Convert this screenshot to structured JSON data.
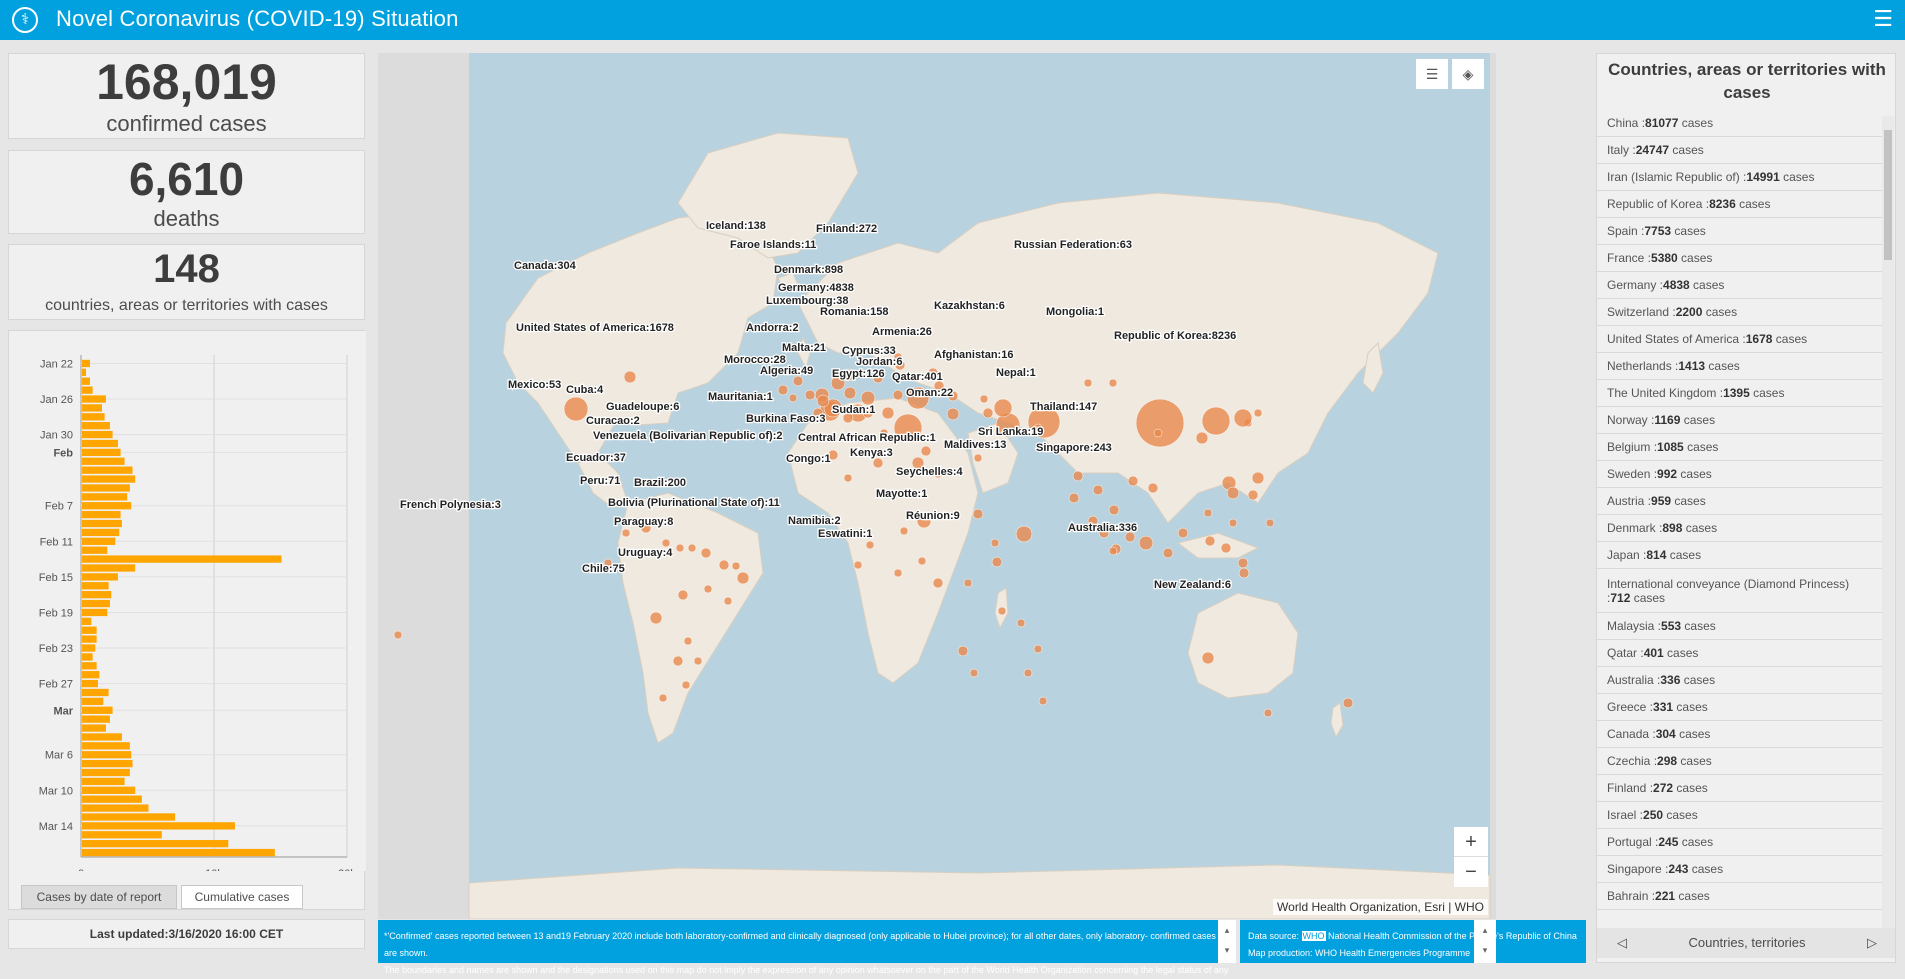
{
  "header": {
    "title": "Novel Coronavirus (COVID-19) Situation",
    "logo": "who-emblem",
    "menu_icon": "☰"
  },
  "stats": {
    "confirmed": "168,019",
    "confirmed_label": "confirmed cases",
    "deaths": "6,610",
    "deaths_label": "deaths",
    "countries": "148",
    "countries_label": "countries, areas or territories with cases"
  },
  "chart_data": {
    "type": "bar",
    "orientation": "horizontal",
    "x_ticks": [
      "0",
      "10k",
      "20k"
    ],
    "xlim": [
      0,
      20000
    ],
    "y_tick_labels": [
      {
        "label": "Jan 22",
        "index": 0,
        "bold": false
      },
      {
        "label": "Jan 26",
        "index": 4,
        "bold": false
      },
      {
        "label": "Jan 30",
        "index": 8,
        "bold": false
      },
      {
        "label": "Feb",
        "index": 10,
        "bold": true
      },
      {
        "label": "Feb 7",
        "index": 16,
        "bold": false
      },
      {
        "label": "Feb 11",
        "index": 20,
        "bold": false
      },
      {
        "label": "Feb 15",
        "index": 24,
        "bold": false
      },
      {
        "label": "Feb 19",
        "index": 28,
        "bold": false
      },
      {
        "label": "Feb 23",
        "index": 32,
        "bold": false
      },
      {
        "label": "Feb 27",
        "index": 36,
        "bold": false
      },
      {
        "label": "Mar",
        "index": 39,
        "bold": true
      },
      {
        "label": "Mar 6",
        "index": 44,
        "bold": false
      },
      {
        "label": "Mar 10",
        "index": 48,
        "bold": false
      },
      {
        "label": "Mar 14",
        "index": 52,
        "bold": false
      }
    ],
    "values": [
      600,
      300,
      600,
      800,
      1800,
      1500,
      1700,
      2100,
      2300,
      2700,
      2900,
      3200,
      3800,
      4000,
      3600,
      3400,
      3700,
      2900,
      3000,
      2800,
      2500,
      1900,
      15000,
      4000,
      2700,
      2000,
      2200,
      2100,
      1900,
      700,
      1100,
      1100,
      1000,
      800,
      1100,
      1300,
      1200,
      2000,
      1600,
      2300,
      2100,
      1800,
      3000,
      3600,
      3700,
      3800,
      3600,
      3200,
      4000,
      4500,
      5000,
      7000,
      11500,
      6000,
      11000,
      14500
    ],
    "color": "#ffa500"
  },
  "chart_tabs": {
    "by_date": "Cases by date of report",
    "cumulative": "Cumulative cases"
  },
  "updated": "Last updated:3/16/2020 16:00 CET",
  "map": {
    "attribution": "World Health Organization, Esri | WHO",
    "zoom_in": "+",
    "zoom_out": "−",
    "legend_icon": "legend-list-icon",
    "layers_icon": "layers-icon",
    "labels": [
      {
        "text": "Iceland:138",
        "x": 328,
        "y": 176
      },
      {
        "text": "Finland:272",
        "x": 438,
        "y": 179
      },
      {
        "text": "Faroe Islands:11",
        "x": 352,
        "y": 195
      },
      {
        "text": "Russian Federation:63",
        "x": 636,
        "y": 195
      },
      {
        "text": "Canada:304",
        "x": 136,
        "y": 216
      },
      {
        "text": "Denmark:898",
        "x": 396,
        "y": 220
      },
      {
        "text": "Germany:4838",
        "x": 400,
        "y": 238
      },
      {
        "text": "Luxembourg:38",
        "x": 388,
        "y": 251
      },
      {
        "text": "Kazakhstan:6",
        "x": 556,
        "y": 256
      },
      {
        "text": "Romania:158",
        "x": 442,
        "y": 262
      },
      {
        "text": "Mongolia:1",
        "x": 668,
        "y": 262
      },
      {
        "text": "Andorra:2",
        "x": 368,
        "y": 278
      },
      {
        "text": "United States of America:1678",
        "x": 138,
        "y": 278
      },
      {
        "text": "Armenia:26",
        "x": 494,
        "y": 282
      },
      {
        "text": "Republic of Korea:8236",
        "x": 736,
        "y": 286
      },
      {
        "text": "Malta:21",
        "x": 404,
        "y": 298
      },
      {
        "text": "Cyprus:33",
        "x": 464,
        "y": 301
      },
      {
        "text": "Afghanistan:16",
        "x": 556,
        "y": 305
      },
      {
        "text": "Morocco:28",
        "x": 346,
        "y": 310
      },
      {
        "text": "Jordan:6",
        "x": 478,
        "y": 312
      },
      {
        "text": "Algeria:49",
        "x": 382,
        "y": 321
      },
      {
        "text": "Egypt:126",
        "x": 454,
        "y": 324
      },
      {
        "text": "Nepal:1",
        "x": 618,
        "y": 323
      },
      {
        "text": "Qatar:401",
        "x": 514,
        "y": 327
      },
      {
        "text": "Mexico:53",
        "x": 130,
        "y": 335
      },
      {
        "text": "Cuba:4",
        "x": 188,
        "y": 340
      },
      {
        "text": "Oman:22",
        "x": 528,
        "y": 343
      },
      {
        "text": "Mauritania:1",
        "x": 330,
        "y": 347
      },
      {
        "text": "Guadeloupe:6",
        "x": 228,
        "y": 357
      },
      {
        "text": "Sudan:1",
        "x": 454,
        "y": 360
      },
      {
        "text": "Thailand:147",
        "x": 652,
        "y": 357
      },
      {
        "text": "Burkina Faso:3",
        "x": 368,
        "y": 369
      },
      {
        "text": "Curacao:2",
        "x": 208,
        "y": 371
      },
      {
        "text": "Sri Lanka:19",
        "x": 600,
        "y": 382
      },
      {
        "text": "Central African Republic:1",
        "x": 420,
        "y": 388
      },
      {
        "text": "Venezuela (Bolivarian Republic of):2",
        "x": 215,
        "y": 386
      },
      {
        "text": "Maldives:13",
        "x": 566,
        "y": 395
      },
      {
        "text": "Singapore:243",
        "x": 658,
        "y": 398
      },
      {
        "text": "Kenya:3",
        "x": 472,
        "y": 403
      },
      {
        "text": "Congo:1",
        "x": 408,
        "y": 409
      },
      {
        "text": "Ecuador:37",
        "x": 188,
        "y": 408
      },
      {
        "text": "Seychelles:4",
        "x": 518,
        "y": 422
      },
      {
        "text": "Peru:71",
        "x": 202,
        "y": 431
      },
      {
        "text": "Brazil:200",
        "x": 256,
        "y": 433
      },
      {
        "text": "Mayotte:1",
        "x": 498,
        "y": 444
      },
      {
        "text": "Bolivia (Plurinational State of):11",
        "x": 230,
        "y": 453
      },
      {
        "text": "French Polynesia:3",
        "x": 22,
        "y": 455
      },
      {
        "text": "Réunion:9",
        "x": 528,
        "y": 466
      },
      {
        "text": "Namibia:2",
        "x": 410,
        "y": 471
      },
      {
        "text": "Paraguay:8",
        "x": 236,
        "y": 472
      },
      {
        "text": "Australia:336",
        "x": 690,
        "y": 478
      },
      {
        "text": "Eswatini:1",
        "x": 440,
        "y": 484
      },
      {
        "text": "Uruguay:4",
        "x": 240,
        "y": 503
      },
      {
        "text": "Chile:75",
        "x": 204,
        "y": 519
      },
      {
        "text": "New Zealand:6",
        "x": 776,
        "y": 535
      }
    ]
  },
  "footer": {
    "left_line1": "*'Confirmed' cases reported between 13 and19 February 2020 include both laboratory-confirmed and clinically diagnosed (only  applicable to Hubei province); for all other dates, only laboratory-  confirmed cases are shown.",
    "left_line2": "The boundaries and names are shown and the designations used on this map do not imply the expression of any opinion whatsoever on the part of the World Health Organization concerning the legal status of any country, territory,",
    "right_line1_a": "Data source: ",
    "right_line1_b": "WHO",
    "right_line1_c": " National Health Commission of the People's Republic of China",
    "right_line2": "Map production: WHO Health Emergencies Programme"
  },
  "right_panel": {
    "title": "Countries, areas or territories with cases",
    "footer": "Countries, territories",
    "rows": [
      {
        "name": "China :",
        "count": "81077",
        "suffix": " cases"
      },
      {
        "name": "Italy :",
        "count": "24747",
        "suffix": " cases"
      },
      {
        "name": "Iran (Islamic Republic of) :",
        "count": "14991",
        "suffix": " cases"
      },
      {
        "name": "Republic of Korea :",
        "count": "8236",
        "suffix": " cases"
      },
      {
        "name": "Spain :",
        "count": "7753",
        "suffix": " cases"
      },
      {
        "name": "France :",
        "count": "5380",
        "suffix": " cases"
      },
      {
        "name": "Germany :",
        "count": "4838",
        "suffix": " cases"
      },
      {
        "name": "Switzerland :",
        "count": "2200",
        "suffix": " cases"
      },
      {
        "name": "United States of America :",
        "count": "1678",
        "suffix": " cases"
      },
      {
        "name": "Netherlands :",
        "count": "1413",
        "suffix": " cases"
      },
      {
        "name": "The United Kingdom :",
        "count": "1395",
        "suffix": " cases"
      },
      {
        "name": "Norway :",
        "count": "1169",
        "suffix": " cases"
      },
      {
        "name": "Belgium :",
        "count": "1085",
        "suffix": " cases"
      },
      {
        "name": "Sweden :",
        "count": "992",
        "suffix": " cases"
      },
      {
        "name": "Austria :",
        "count": "959",
        "suffix": " cases"
      },
      {
        "name": "Denmark :",
        "count": "898",
        "suffix": " cases"
      },
      {
        "name": "Japan :",
        "count": "814",
        "suffix": " cases"
      },
      {
        "name": "International conveyance (Diamond Princess) :",
        "count": "712",
        "suffix": " cases"
      },
      {
        "name": "Malaysia :",
        "count": "553",
        "suffix": " cases"
      },
      {
        "name": "Qatar :",
        "count": "401",
        "suffix": " cases"
      },
      {
        "name": "Australia :",
        "count": "336",
        "suffix": " cases"
      },
      {
        "name": "Greece :",
        "count": "331",
        "suffix": " cases"
      },
      {
        "name": "Canada :",
        "count": "304",
        "suffix": " cases"
      },
      {
        "name": "Czechia :",
        "count": "298",
        "suffix": " cases"
      },
      {
        "name": "Finland :",
        "count": "272",
        "suffix": " cases"
      },
      {
        "name": "Israel :",
        "count": "250",
        "suffix": " cases"
      },
      {
        "name": "Portugal :",
        "count": "245",
        "suffix": " cases"
      },
      {
        "name": "Singapore :",
        "count": "243",
        "suffix": " cases"
      },
      {
        "name": "Bahrain :",
        "count": "221",
        "suffix": " cases"
      }
    ]
  }
}
